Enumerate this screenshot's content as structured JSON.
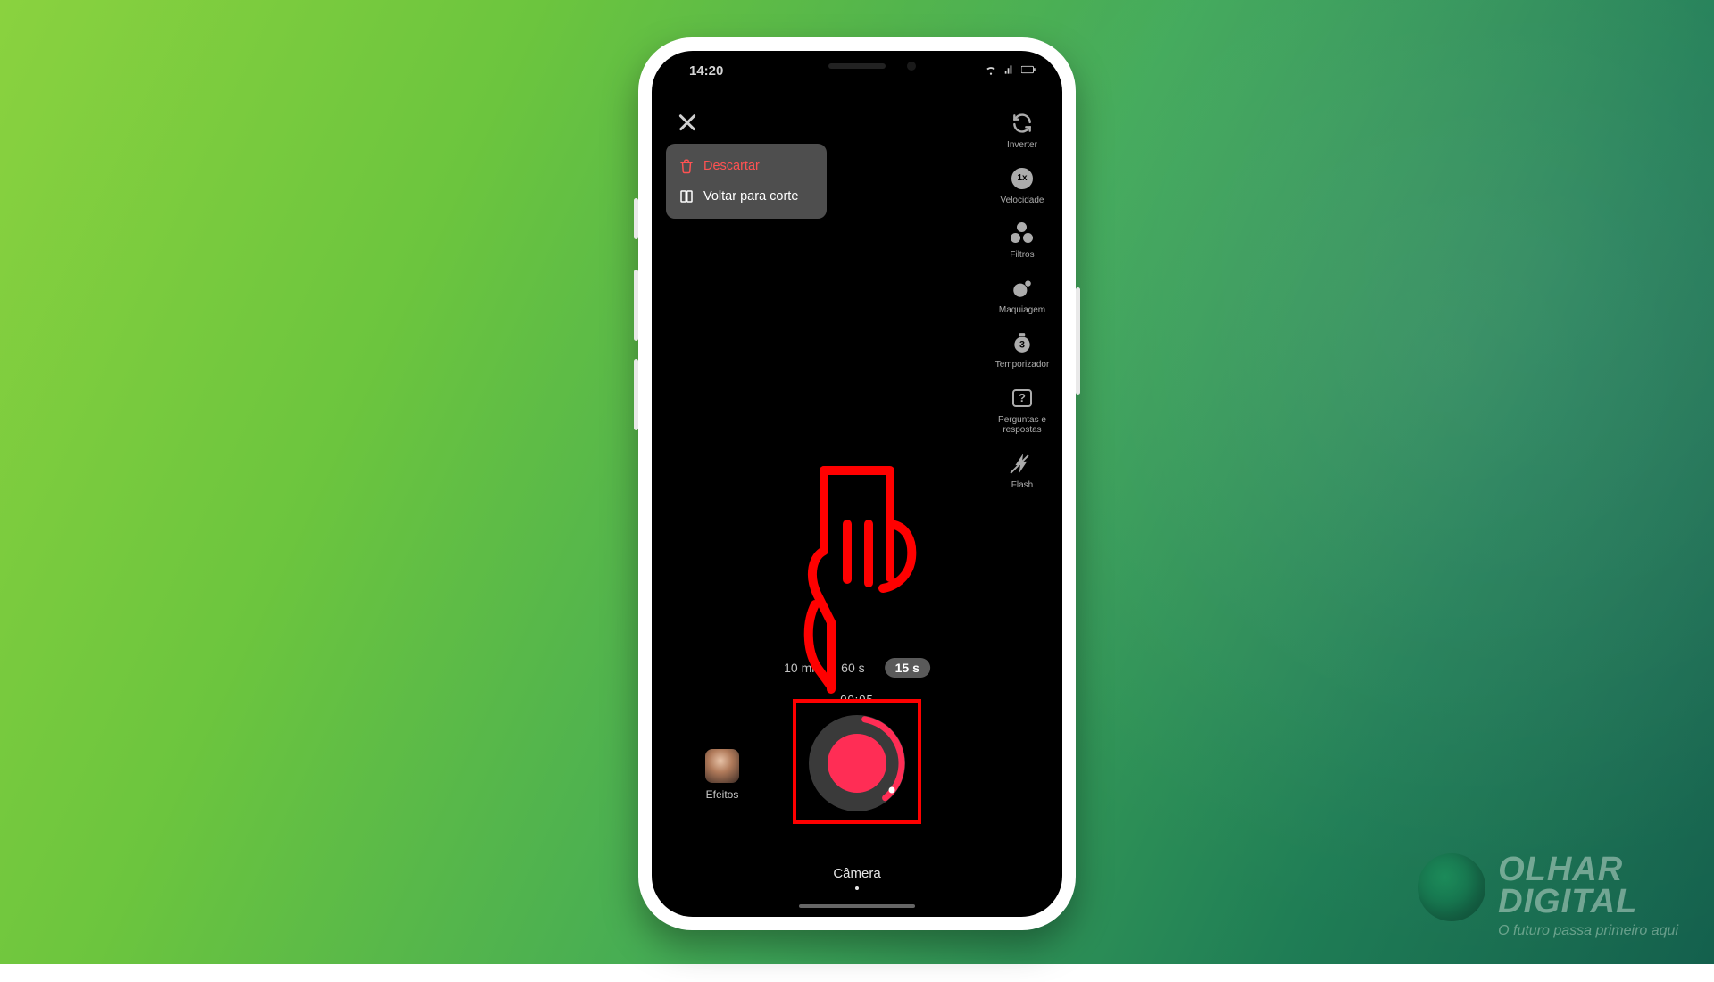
{
  "statusbar": {
    "time": "14:20"
  },
  "popup": {
    "discard": "Descartar",
    "back": "Voltar para corte"
  },
  "tools": {
    "invert": "Inverter",
    "speed_badge": "1x",
    "speed": "Velocidade",
    "filters": "Filtros",
    "makeup": "Maquiagem",
    "timer_badge": "3",
    "timer": "Temporizador",
    "qa": "Perguntas e respostas",
    "flash": "Flash"
  },
  "durations": {
    "opt1": "10 min",
    "opt2": "60 s",
    "opt3": "15 s"
  },
  "recording": {
    "elapsed": "00:05"
  },
  "effects": {
    "label": "Efeitos"
  },
  "bottom": {
    "camera": "Câmera"
  },
  "watermark": {
    "line1": "OLHAR",
    "line2": "DIGITAL",
    "tagline": "O futuro passa primeiro aqui"
  }
}
